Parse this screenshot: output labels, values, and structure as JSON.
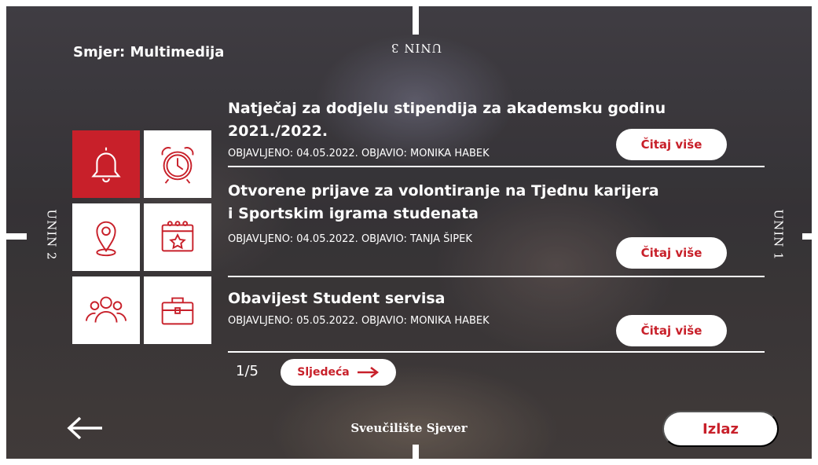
{
  "header": {
    "direction_label": "Smjer: Multimedija"
  },
  "room_labels": {
    "top": "UNIN 3",
    "left": "UNIN 2",
    "right": "UNIN 1"
  },
  "menu": {
    "tiles": [
      {
        "icon": "bell-icon",
        "active": true
      },
      {
        "icon": "alarm-clock-icon",
        "active": false
      },
      {
        "icon": "location-pin-icon",
        "active": false
      },
      {
        "icon": "calendar-star-icon",
        "active": false
      },
      {
        "icon": "group-icon",
        "active": false
      },
      {
        "icon": "briefcase-icon",
        "active": false
      }
    ]
  },
  "news": {
    "items": [
      {
        "title": "Natječaj za dodjelu stipendija za akademsku godinu 2021./2022.",
        "meta": "OBJAVLJENO: 04.05.2022. OBJAVIO: MONIKA HABEK",
        "button": "Čitaj više"
      },
      {
        "title": "Otvorene prijave za volontiranje na Tjednu karijera i Sportskim igrama studenata",
        "meta": "OBJAVLJENO: 04.05.2022. OBJAVIO: TANJA ŠIPEK",
        "button": "Čitaj više"
      },
      {
        "title": "Obavijest Student servisa",
        "meta": "OBJAVLJENO: 05.05.2022. OBJAVIO: MONIKA HABEK",
        "button": "Čitaj više"
      }
    ]
  },
  "pagination": {
    "current": "1/5",
    "next_label": "Sljedeća"
  },
  "footer": {
    "university": "Sveučilište Sjever",
    "exit_label": "Izlaz"
  },
  "colors": {
    "accent": "#c8202a",
    "text": "#ffffff"
  }
}
